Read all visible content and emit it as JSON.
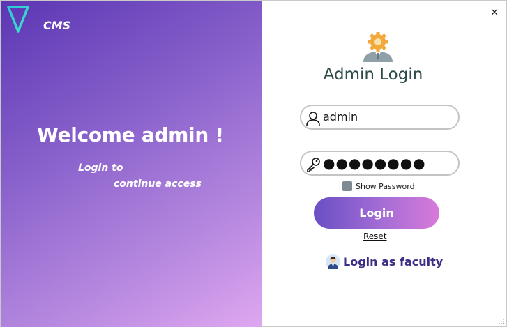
{
  "app": {
    "name": "CMS"
  },
  "left_panel": {
    "welcome": "Welcome admin !",
    "subtitle_line1": "Login to",
    "subtitle_line2": "continue access"
  },
  "login_form": {
    "title": "Admin Login",
    "username_value": "admin",
    "password_mask": "●●●●●●●●",
    "show_password_label": "Show Password",
    "show_password_checked": false,
    "login_button": "Login",
    "reset_link": "Reset",
    "faculty_link": "Login as faculty"
  },
  "window": {
    "close_glyph": "×"
  },
  "icons": {
    "logo": "triangle-logo-icon",
    "admin": "admin-gear-avatar-icon",
    "username": "user-icon",
    "password": "key-icon",
    "faculty": "faculty-avatar-icon"
  },
  "colors": {
    "gradient_start": "#5b36b3",
    "gradient_end": "#e0a7f0",
    "title_text": "#2e4a4a",
    "faculty_link": "#3b2f86",
    "button_start": "#6a4fc4",
    "button_end": "#d77ad9"
  }
}
